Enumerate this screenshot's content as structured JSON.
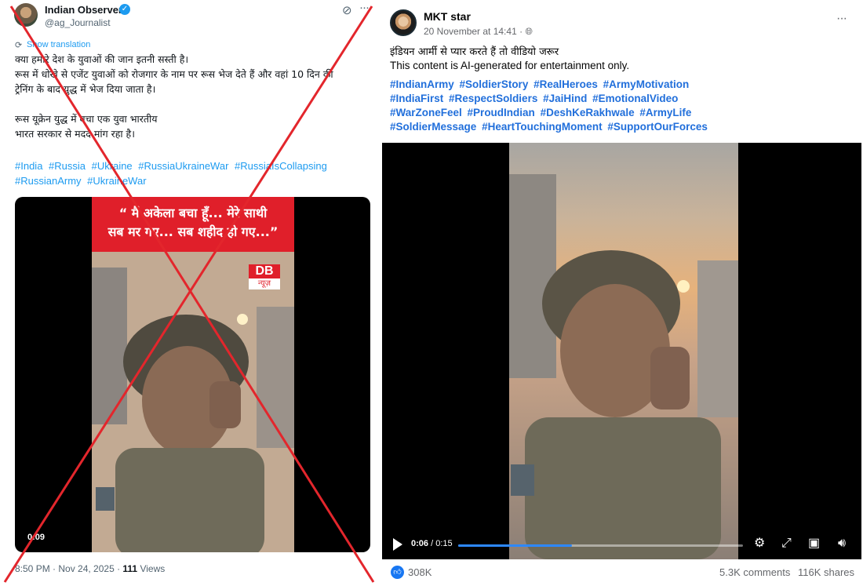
{
  "twitter": {
    "display_name": "Indian Observer",
    "handle": "@ag_Journalist",
    "show_translation": "Show translation",
    "text_lines": [
      "क्या हमारे देश के युवाओं की जान इतनी सस्ती है।",
      "रूस में धोखे से एजेंट युवाओं को रोजगार के नाम पर रूस भेज देते हैं और वहां 10 दिन की",
      "ट्रेनिंग के बाद युद्ध में भेज दिया जाता है।",
      "",
      "रूस यूक्रेन युद्ध में बचा एक युवा भारतीय",
      "भारत सरकार से मदद मांग रहा है।"
    ],
    "hashtags": [
      "#India",
      "#Russia",
      "#Ukraine",
      "#RussiaUkraineWar",
      "#RussiaIsCollapsing",
      "#RussianArmy",
      "#UkraineWar"
    ],
    "video_caption_line1": "“ मैं अकेला बचा हूँ... मेरे साथी",
    "video_caption_line2": "सब मर गए... सब शहीद हो गए...”",
    "logo_top": "DB",
    "logo_bottom": "न्यूज़",
    "video_time": "0:09",
    "timestamp": "8:50 PM · Nov 24, 2025 · ",
    "views_count": "111",
    "views_label": " Views",
    "cross_color": "#e3262c"
  },
  "facebook": {
    "page_name": "MKT star",
    "date": "20 November at 14:41 · ",
    "line1": "इंडियन आर्मी से प्यार करते हैं तो वीडियो जरूर",
    "line2": "This content is AI-generated for entertainment only.",
    "hashtags": [
      "#IndianArmy",
      "#SoldierStory",
      "#RealHeroes",
      "#ArmyMotivation",
      "#IndiaFirst",
      "#RespectSoldiers",
      "#JaiHind",
      "#EmotionalVideo",
      "#WarZoneFeel",
      "#ProudIndian",
      "#DeshKeRakhwale",
      "#ArmyLife",
      "#SoldierMessage",
      "#HeartTouchingMoment",
      "#SupportOurForces"
    ],
    "video_current": "0:06",
    "video_total": " / 0:15",
    "progress_fraction": 0.4,
    "reactions": "308K",
    "comments": "5.3K comments",
    "shares": "116K shares",
    "icons": [
      "globe-icon",
      "play-icon",
      "settings-icon",
      "fullscreen-icon",
      "pip-icon",
      "volume-icon",
      "like-icon"
    ]
  }
}
